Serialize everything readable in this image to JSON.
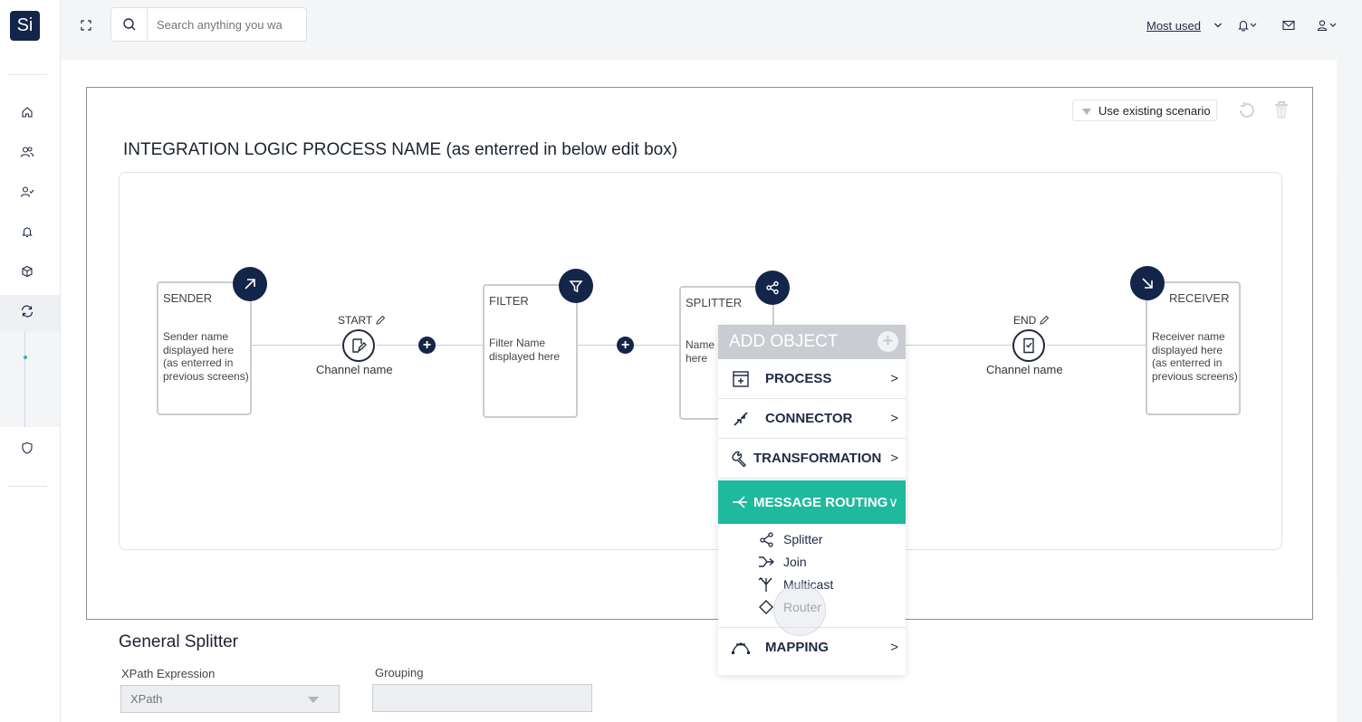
{
  "app": {
    "logo_text": "Si"
  },
  "topbar": {
    "search_placeholder": "Search anything you wa",
    "most_used": "Most used"
  },
  "sidebar": {
    "items": [
      {
        "icon": "home-icon"
      },
      {
        "icon": "users-icon"
      },
      {
        "icon": "user-check-icon"
      },
      {
        "icon": "bell-icon"
      },
      {
        "icon": "box-icon"
      },
      {
        "icon": "sync-icon",
        "active": true
      },
      {
        "icon": "shield-icon"
      }
    ]
  },
  "scenario": {
    "label": "Use existing scenario"
  },
  "process": {
    "title": "INTEGRATION LOGIC PROCESS NAME (as enterred in below edit box)"
  },
  "nodes": {
    "sender": {
      "title": "SENDER",
      "desc": "Sender name displayed here (as enterred in previous screens)"
    },
    "start": {
      "label": "START",
      "channel": "Channel name"
    },
    "filter": {
      "title": "FILTER",
      "desc": "Filter Name displayed here"
    },
    "splitter": {
      "title": "SPLITTER",
      "desc_line1": "Name o",
      "desc_line2": "here"
    },
    "end": {
      "label": "END",
      "channel": "Channel name"
    },
    "receiver": {
      "title": "RECEIVER",
      "desc": "Receiver name displayed here (as enterred in previous screens)"
    }
  },
  "menu": {
    "header": "ADD OBJECT",
    "items": [
      {
        "label": "PROCESS",
        "chevron": ">"
      },
      {
        "label": "CONNECTOR",
        "chevron": ">"
      },
      {
        "label": "TRANSFORMATION",
        "chevron": ">"
      },
      {
        "label": "MESSAGE ROUTING",
        "chevron": "∨",
        "active": true
      },
      {
        "label": "MAPPING",
        "chevron": ">"
      }
    ],
    "routing_options": [
      "Splitter",
      "Join",
      "Multicast",
      "Router"
    ]
  },
  "form": {
    "section_title": "General Splitter",
    "xpath_label": "XPath Expression",
    "xpath_value": "XPath",
    "grouping_label": "Grouping",
    "grouping_value": ""
  },
  "colors": {
    "navy": "#14254a",
    "teal": "#1fb99e",
    "accent_dot": "#2db7c4"
  }
}
